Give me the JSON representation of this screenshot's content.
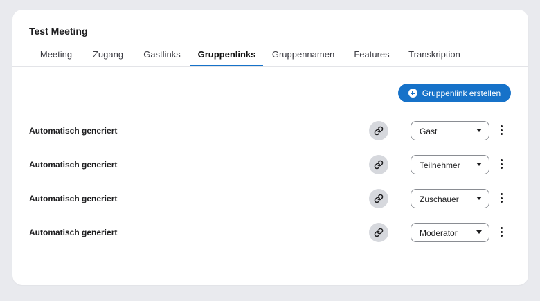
{
  "meeting": {
    "title": "Test Meeting"
  },
  "tabs": [
    {
      "label": "Meeting"
    },
    {
      "label": "Zugang"
    },
    {
      "label": "Gastlinks"
    },
    {
      "label": "Gruppenlinks",
      "active": true
    },
    {
      "label": "Gruppennamen"
    },
    {
      "label": "Features"
    },
    {
      "label": "Transkription"
    }
  ],
  "actions": {
    "create_label": "Gruppenlink erstellen"
  },
  "group_links": [
    {
      "name": "Automatisch generiert",
      "role": "Gast"
    },
    {
      "name": "Automatisch generiert",
      "role": "Teilnehmer"
    },
    {
      "name": "Automatisch generiert",
      "role": "Zuschauer"
    },
    {
      "name": "Automatisch generiert",
      "role": "Moderator"
    }
  ],
  "colors": {
    "accent": "#1672c9",
    "background": "#e9eaee",
    "card": "#ffffff",
    "link_button": "#d6d8dd"
  },
  "icons": {
    "create": "plus-circle-icon",
    "link": "link-icon",
    "dropdown": "caret-down-icon",
    "more": "more-vertical-icon"
  }
}
